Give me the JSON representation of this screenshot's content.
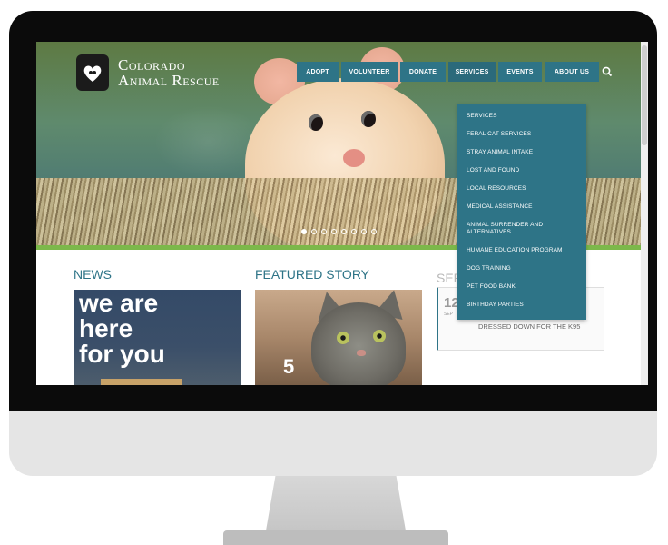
{
  "site": {
    "logo": {
      "line1": "Colorado",
      "line2": "Animal Rescue"
    }
  },
  "nav": {
    "items": [
      "ADOPT",
      "VOLUNTEER",
      "DONATE",
      "SERVICES",
      "EVENTS",
      "ABOUT US"
    ],
    "search_icon": "search-icon"
  },
  "services_menu": {
    "items": [
      "SERVICES",
      "FERAL CAT SERVICES",
      "STRAY ANIMAL INTAKE",
      "LOST AND FOUND",
      "LOCAL RESOURCES",
      "MEDICAL ASSISTANCE",
      "ANIMAL SURRENDER AND ALTERNATIVES",
      "HUMANE EDUCATION PROGRAM",
      "DOG TRAINING",
      "PET FOOD BANK",
      "BIRTHDAY PARTIES"
    ]
  },
  "slider": {
    "dot_count": 8,
    "active_index": 0
  },
  "news": {
    "title": "NEWS",
    "image_lines": [
      "we are",
      "here",
      "for you"
    ]
  },
  "featured": {
    "title": "FEATURED STORY",
    "overlay_number": "5"
  },
  "events": {
    "title": "SEP",
    "card": {
      "day": "12",
      "month": "SEP",
      "title": "DRESSED DOWN FOR THE K95"
    }
  },
  "colors": {
    "nav_teal": "#2e7487",
    "accent_green": "#7cb84a",
    "bezel": "#0b0b0b"
  }
}
